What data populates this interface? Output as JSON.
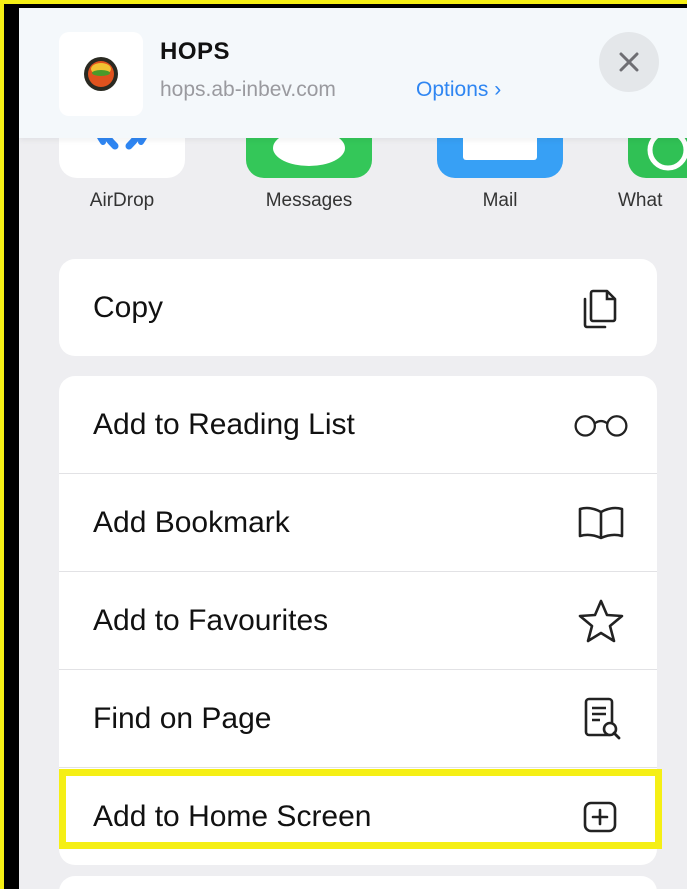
{
  "header": {
    "title": "HOPS",
    "url": "hops.ab-inbev.com",
    "options_label": "Options ›",
    "close_icon": "close-icon"
  },
  "share_apps": [
    {
      "label": "AirDrop",
      "color": "#ffffff"
    },
    {
      "label": "Messages",
      "color": "#34c759"
    },
    {
      "label": "Mail",
      "color": "#37a0f5"
    },
    {
      "label": "What",
      "color": "#30c155"
    }
  ],
  "actions": {
    "copy": {
      "label": "Copy",
      "icon": "copy-icon"
    },
    "reading_list": {
      "label": "Add to Reading List",
      "icon": "glasses-icon"
    },
    "bookmark": {
      "label": "Add Bookmark",
      "icon": "book-icon"
    },
    "favourites": {
      "label": "Add to Favourites",
      "icon": "star-icon"
    },
    "find": {
      "label": "Find on Page",
      "icon": "find-page-icon"
    },
    "home_screen": {
      "label": "Add to Home Screen",
      "icon": "add-square-icon"
    }
  },
  "colors": {
    "highlight": "#f5ef15",
    "link": "#2f86f2",
    "sheet_bg": "#eeeef1"
  }
}
